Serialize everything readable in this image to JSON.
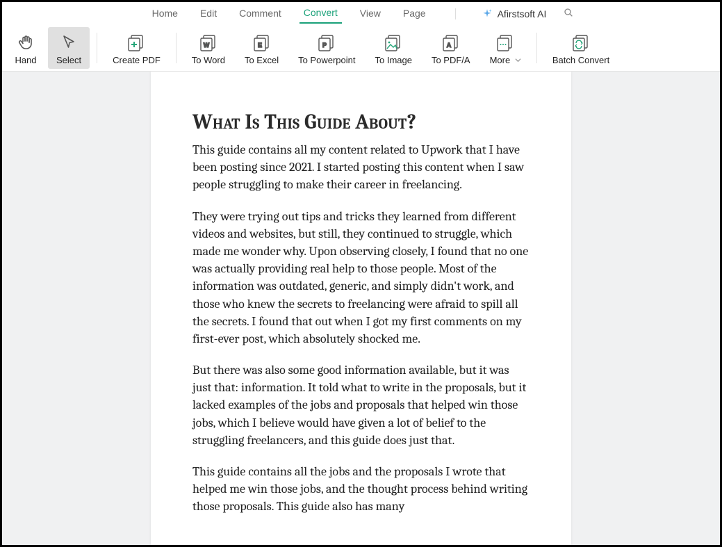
{
  "menubar": {
    "items": [
      {
        "label": "Home"
      },
      {
        "label": "Edit"
      },
      {
        "label": "Comment"
      },
      {
        "label": "Convert",
        "active": true
      },
      {
        "label": "View"
      },
      {
        "label": "Page"
      }
    ],
    "brand": "Afirstsoft AI"
  },
  "toolbar": {
    "hand": "Hand",
    "select": "Select",
    "create_pdf": "Create PDF",
    "to_word": "To Word",
    "to_excel": "To Excel",
    "to_ppt": "To Powerpoint",
    "to_image": "To Image",
    "to_pdfa": "To PDF/A",
    "more": "More",
    "batch": "Batch Convert"
  },
  "document": {
    "heading": "What Is This Guide About?",
    "p1": "This guide contains all my content related to Upwork that I have been posting since 2021. I started posting this content when I saw people struggling to make their career in freelancing.",
    "p2": "They were trying out tips and tricks they learned from different videos and websites, but still, they continued to struggle, which made me wonder why. Upon observing closely, I found that no one was actually providing real help to those people. Most of the information was outdated, generic, and simply didn't work, and those who knew the secrets to freelancing were afraid to spill all the secrets. I found that out when I got my first comments on my first-ever post, which absolutely shocked me.",
    "p3": "But there was also some good information available, but it was just that: information. It told what to write in the proposals, but it lacked examples of the jobs and proposals that helped win those jobs, which I believe would have given a lot of belief to the struggling freelancers, and this guide does just that.",
    "p4": "This guide contains all the jobs and the proposals I wrote that helped me win those jobs, and the thought process behind writing those proposals. This guide also has many"
  }
}
